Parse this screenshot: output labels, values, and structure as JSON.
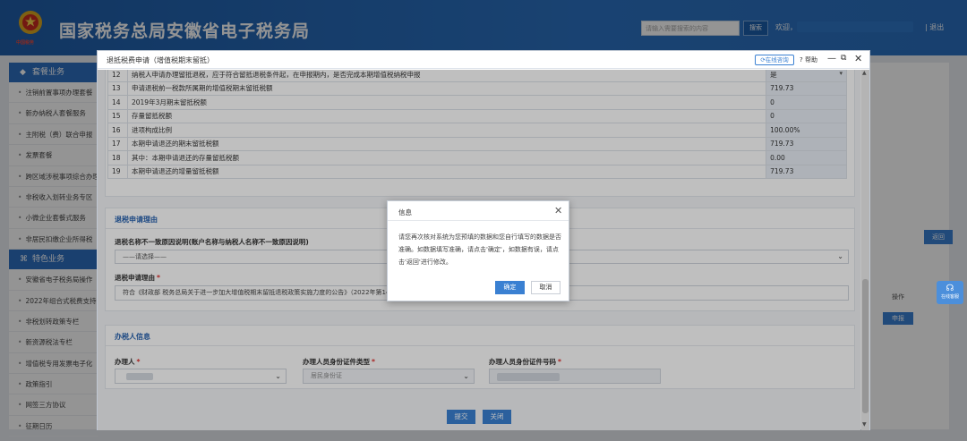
{
  "header": {
    "title": "国家税务总局安徽省电子税务局",
    "emblem_caption": "中国税务",
    "search_placeholder": "请输入需要搜索的内容",
    "search_label": "搜索",
    "welcome": "欢迎，",
    "logout": "| 退出"
  },
  "sidebar": {
    "section1": "套餐业务",
    "items1": [
      "注销前置事项办理套餐",
      "新办纳税人套餐服务",
      "主附税（费）联合申报",
      "发票套餐",
      "跨区域涉税事项综合办理",
      "非税收入划转业务专区",
      "小微企业套餐式服务",
      "非居民扣缴企业所得税"
    ],
    "section2": "特色业务",
    "items2": [
      "安徽省电子税务局操作",
      "2022年组合式税费支持",
      "非税划转政策专栏",
      "新资源税法专栏",
      "增值税专用发票电子化",
      "政策指引",
      "网签三方协议",
      "征期日历"
    ]
  },
  "background": {
    "return_label": "返回",
    "op_label": "操作",
    "report_label": "申报",
    "service_label": "在线客服"
  },
  "dialog": {
    "title": "退抵税费申请（增值税期末留抵）",
    "online_label": "在线咨询",
    "help_label": "? 帮助",
    "rows": [
      {
        "num": "12",
        "desc": "纳税人申请办理留抵退税，应于符合留抵退税条件起，在申报期内，是否完成本期增值税纳税申报",
        "value": "是"
      },
      {
        "num": "13",
        "desc": "申请退税前一税款所属期的增值税期末留抵税额",
        "value": "719.73"
      },
      {
        "num": "14",
        "desc": "2019年3月期末留抵税额",
        "value": "0"
      },
      {
        "num": "15",
        "desc": "存量留抵税额",
        "value": "0"
      },
      {
        "num": "16",
        "desc": "进项构成比例",
        "value": "100.00%"
      },
      {
        "num": "17",
        "desc": "本期申请退还的期末留抵税额",
        "value": "719.73"
      },
      {
        "num": "18",
        "desc": "其中：本期申请退还的存量留抵税额",
        "value": "0.00"
      },
      {
        "num": "19",
        "desc": "本期申请退还的增量留抵税额",
        "value": "719.73"
      }
    ],
    "reason": {
      "section_title": "退税申请理由",
      "name_mismatch_label": "退税名称不一致原因说明(账户名称与纳税人名称不一致原因说明)",
      "select_value": "——请选择——",
      "reason_label": "退税申请理由",
      "reason_text": "符合《财政部 税务总局关于进一步加大增值税期末留抵退税政策实施力度的公告》（2022年第14号）"
    },
    "agent": {
      "section_title": "办税人信息",
      "agent_label": "办理人",
      "id_type_label": "办理人员身份证件类型",
      "id_type_value": "居民身份证",
      "id_no_label": "办理人员身份证件号码"
    },
    "submit_label": "提交",
    "close_label": "关闭"
  },
  "popup": {
    "title": "信息",
    "message": "请您再次核对系统为您预填的数据和您自行填写的数据是否准确。如数据填写准确，请点击'确定'，如数据有误，请点击'返回'进行修改。",
    "ok_label": "确定",
    "cancel_label": "取消"
  }
}
